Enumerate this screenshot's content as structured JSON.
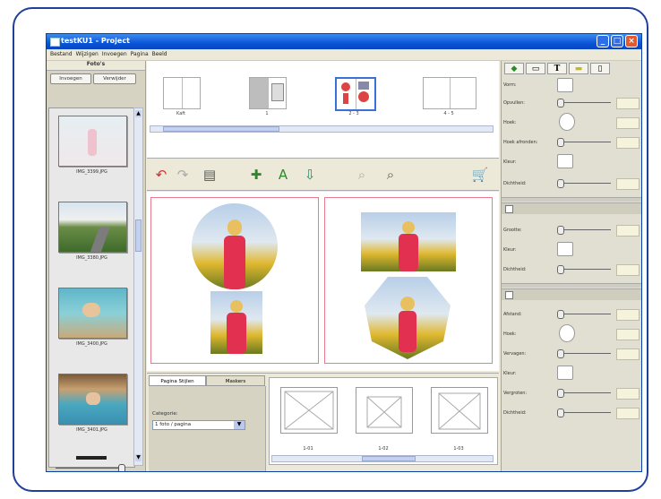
{
  "window": {
    "title": "testKU1 - Project"
  },
  "menu": [
    "Bestand",
    "Wijzigen",
    "Invoegen",
    "Pagina",
    "Beeld"
  ],
  "left": {
    "header": "Foto's",
    "add_button": "Invoegen",
    "remove_button": "Verwijder",
    "photos": [
      "IMG_3399.JPG",
      "IMG_3380.JPG",
      "IMG_3400.JPG",
      "IMG_3401.JPG"
    ]
  },
  "spreads": [
    "Kaft",
    "1",
    "2 - 3",
    "4 - 5"
  ],
  "toolbar_icons": [
    "undo-icon",
    "redo-icon",
    "print-icon",
    "add-photo-icon",
    "add-text-icon",
    "export-icon",
    "zoom-out-icon",
    "zoom-in-icon",
    "cart-icon"
  ],
  "bottom": {
    "tab1": "Pagina Stijlen",
    "tab2": "Maskers",
    "category_label": "Categorie:",
    "category_value": "1 foto / pagina",
    "layouts": [
      "1-01",
      "1-02",
      "1-03"
    ]
  },
  "props": {
    "section1": [
      "Vorm:",
      "Opvullen:",
      "Hoek:",
      "Hoek afronden:",
      "Kleur:",
      "Dichtheid:"
    ],
    "section2": [
      "Grootte:",
      "Kleur:",
      "Dichtheid:"
    ],
    "section3": [
      "Afstand:",
      "Hoek:",
      "Vervagen:",
      "Kleur:",
      "Vergroten:",
      "Dichtheid:"
    ]
  },
  "colors": {
    "title_bar": "#0a55d8",
    "page_border": "#e87a8e",
    "frame_border": "#1f3f9a"
  }
}
